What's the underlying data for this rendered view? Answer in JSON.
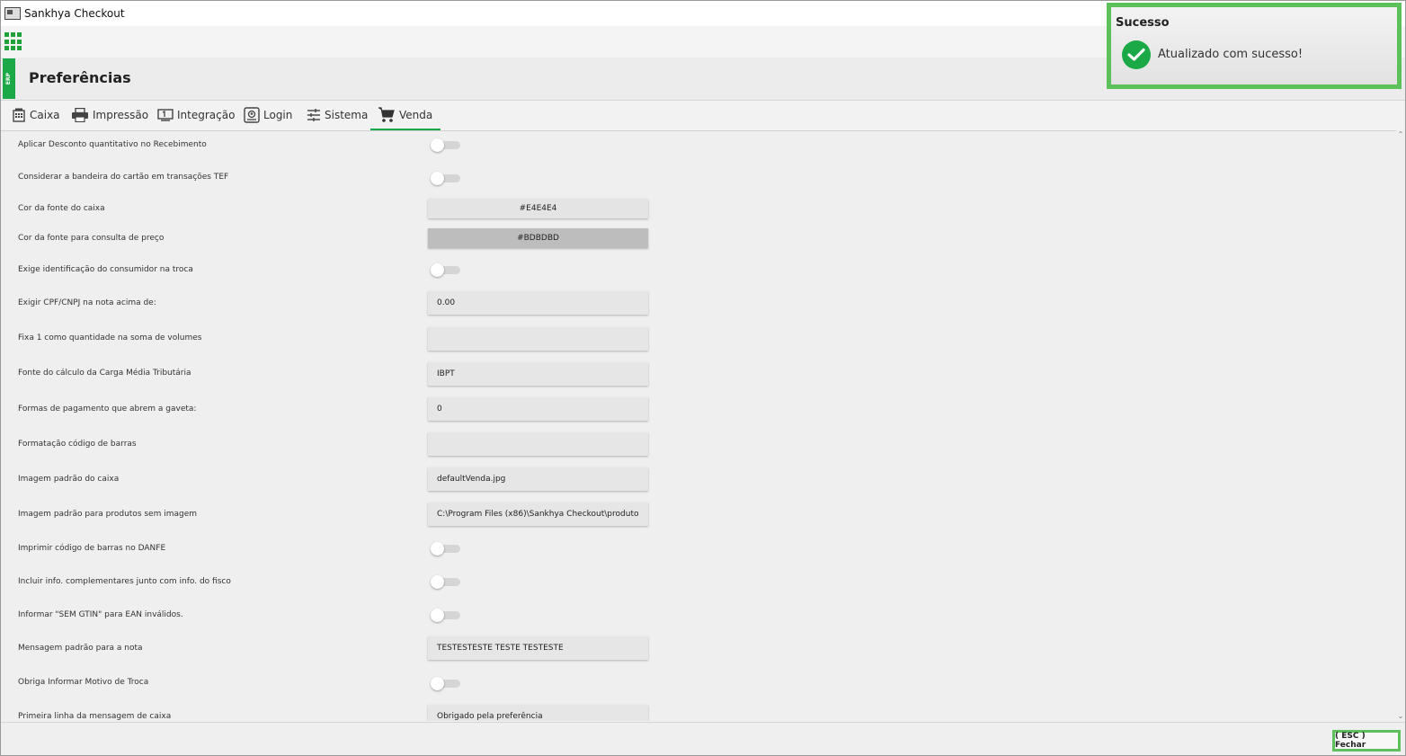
{
  "window": {
    "title": "Sankhya Checkout"
  },
  "header": {
    "erp_label": "ERP",
    "page_title": "Preferências"
  },
  "tabs": [
    {
      "label": "Caixa",
      "icon": "cash-register-icon"
    },
    {
      "label": "Impressão",
      "icon": "printer-icon"
    },
    {
      "label": "Integração",
      "icon": "integration-icon"
    },
    {
      "label": "Login",
      "icon": "login-badge-icon"
    },
    {
      "label": "Sistema",
      "icon": "sliders-icon"
    },
    {
      "label": "Venda",
      "icon": "cart-icon",
      "active": true
    }
  ],
  "rows": [
    {
      "label": "Aplicar Desconto quantitativo no Recebimento",
      "type": "toggle",
      "on": false
    },
    {
      "label": "Considerar a bandeira do cartão em transações TEF",
      "type": "toggle",
      "on": false
    },
    {
      "label": "Cor da fonte do caixa",
      "type": "color",
      "value": "#E4E4E4"
    },
    {
      "label": "Cor da fonte para consulta de preço",
      "type": "color",
      "value": "#BDBDBD"
    },
    {
      "label": "Exige identificação do consumidor na troca",
      "type": "toggle",
      "on": false
    },
    {
      "label": "Exigir CPF/CNPJ na nota acima de:",
      "type": "text",
      "value": "0.00"
    },
    {
      "label": "Fixa 1 como quantidade na soma de volumes",
      "type": "text",
      "value": ""
    },
    {
      "label": "Fonte do cálculo da Carga Média Tributária",
      "type": "text",
      "value": "IBPT"
    },
    {
      "label": "Formas de pagamento que abrem a gaveta:",
      "type": "text",
      "value": "0"
    },
    {
      "label": "Formatação código de barras",
      "type": "text",
      "value": ""
    },
    {
      "label": "Imagem padrão do caixa",
      "type": "text",
      "value": "defaultVenda.jpg"
    },
    {
      "label": "Imagem padrão para produtos sem imagem",
      "type": "text",
      "value": "C:\\Program Files (x86)\\Sankhya Checkout\\produto"
    },
    {
      "label": "Imprimir código de barras no DANFE",
      "type": "toggle",
      "on": false
    },
    {
      "label": "Incluir info. complementares junto com info. do fisco",
      "type": "toggle",
      "on": false
    },
    {
      "label": "Informar \"SEM GTIN\" para EAN inválidos.",
      "type": "toggle",
      "on": false
    },
    {
      "label": "Mensagem padrão para a nota",
      "type": "text",
      "value": "TESTESTESTE TESTE TESTESTE"
    },
    {
      "label": "Obriga Informar Motivo de Troca",
      "type": "toggle",
      "on": false
    },
    {
      "label": "Primeira linha da mensagem de caixa",
      "type": "text",
      "value": "Obrigado pela preferência"
    }
  ],
  "toast": {
    "title": "Sucesso",
    "message": "Atualizado com sucesso!",
    "icon": "check-circle-icon"
  },
  "footer": {
    "close_label": "( ESC ) Fechar"
  },
  "colors": {
    "accent": "#1aa946",
    "highlight": "#5cc15a"
  }
}
